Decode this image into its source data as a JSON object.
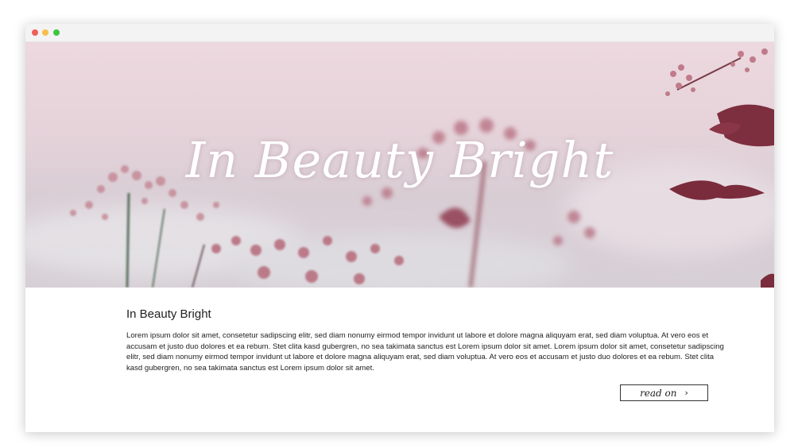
{
  "window": {
    "controls": {
      "close_color": "#ee5f5a",
      "minimize_color": "#f6be4f",
      "maximize_color": "#3cc73f"
    }
  },
  "hero": {
    "title": "In Beauty Bright",
    "image": "pink-wildflowers-photo"
  },
  "article": {
    "title": "In Beauty Bright",
    "body": "Lorem ipsum dolor sit amet, consetetur sadipscing elitr, sed diam nonumy eirmod tempor invidunt ut labore et dolore magna aliquyam erat, sed diam voluptua. At vero eos et accusam et justo duo dolores et ea rebum. Stet clita kasd gubergren, no sea takimata sanctus est Lorem ipsum dolor sit amet. Lorem ipsum dolor sit amet, consetetur sadipscing elitr, sed diam nonumy eirmod tempor invidunt ut labore et dolore magna aliquyam erat, sed diam voluptua. At vero eos et accusam et justo duo dolores et ea rebum. Stet clita kasd gubergren, no sea takimata sanctus est Lorem ipsum dolor sit amet.",
    "read_on_label": "read on",
    "read_on_icon": "chevron-right-icon"
  }
}
